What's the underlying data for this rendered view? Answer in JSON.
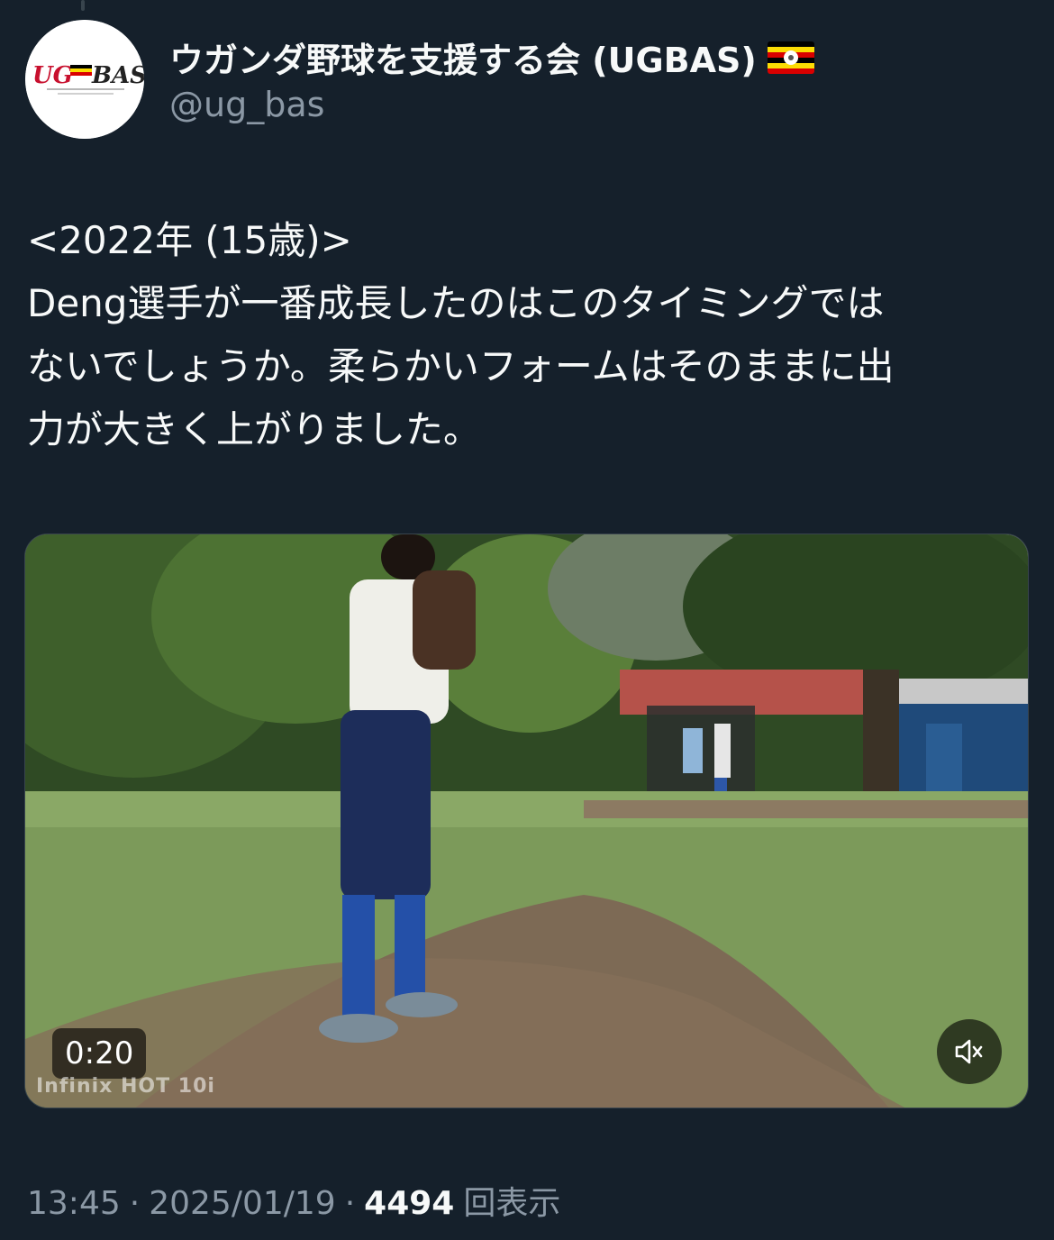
{
  "author": {
    "display_name": "ウガンダ野球を支援する会 (UGBAS)",
    "handle": "@ug_bas",
    "avatar_logo_text": "UG BAS",
    "flag": "uganda-flag-icon"
  },
  "tweet": {
    "lines": [
      "<2022年 (15歳)>",
      "Deng選手が一番成長したのはこのタイミングでは",
      "ないでしょうか。柔らかいフォームはそのままに出",
      "力が大きく上がりました。"
    ]
  },
  "video": {
    "duration": "0:20",
    "watermark": "Infinix HOT 10i",
    "muted": true
  },
  "meta": {
    "time": "13:45",
    "separator": "·",
    "date": "2025/01/19",
    "views_count": "4494",
    "views_label": "回表示"
  },
  "colors": {
    "background": "#15202b",
    "primary_text": "#f7f9f9",
    "secondary_text": "#8b98a5",
    "border": "#38444d"
  }
}
